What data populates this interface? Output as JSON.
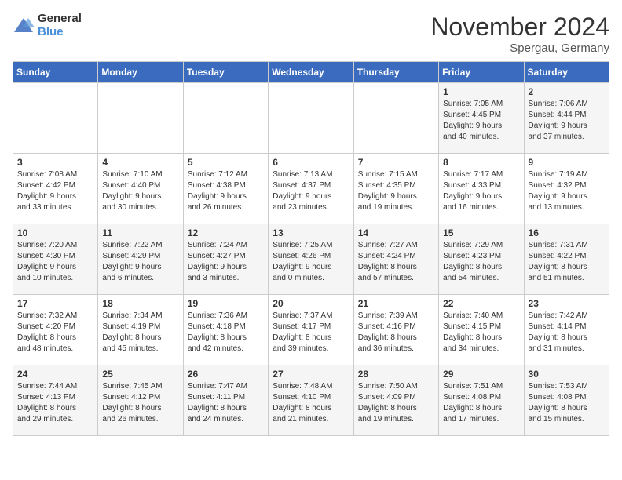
{
  "logo": {
    "general": "General",
    "blue": "Blue"
  },
  "title": "November 2024",
  "subtitle": "Spergau, Germany",
  "headers": [
    "Sunday",
    "Monday",
    "Tuesday",
    "Wednesday",
    "Thursday",
    "Friday",
    "Saturday"
  ],
  "weeks": [
    [
      {
        "day": "",
        "info": ""
      },
      {
        "day": "",
        "info": ""
      },
      {
        "day": "",
        "info": ""
      },
      {
        "day": "",
        "info": ""
      },
      {
        "day": "",
        "info": ""
      },
      {
        "day": "1",
        "info": "Sunrise: 7:05 AM\nSunset: 4:45 PM\nDaylight: 9 hours\nand 40 minutes."
      },
      {
        "day": "2",
        "info": "Sunrise: 7:06 AM\nSunset: 4:44 PM\nDaylight: 9 hours\nand 37 minutes."
      }
    ],
    [
      {
        "day": "3",
        "info": "Sunrise: 7:08 AM\nSunset: 4:42 PM\nDaylight: 9 hours\nand 33 minutes."
      },
      {
        "day": "4",
        "info": "Sunrise: 7:10 AM\nSunset: 4:40 PM\nDaylight: 9 hours\nand 30 minutes."
      },
      {
        "day": "5",
        "info": "Sunrise: 7:12 AM\nSunset: 4:38 PM\nDaylight: 9 hours\nand 26 minutes."
      },
      {
        "day": "6",
        "info": "Sunrise: 7:13 AM\nSunset: 4:37 PM\nDaylight: 9 hours\nand 23 minutes."
      },
      {
        "day": "7",
        "info": "Sunrise: 7:15 AM\nSunset: 4:35 PM\nDaylight: 9 hours\nand 19 minutes."
      },
      {
        "day": "8",
        "info": "Sunrise: 7:17 AM\nSunset: 4:33 PM\nDaylight: 9 hours\nand 16 minutes."
      },
      {
        "day": "9",
        "info": "Sunrise: 7:19 AM\nSunset: 4:32 PM\nDaylight: 9 hours\nand 13 minutes."
      }
    ],
    [
      {
        "day": "10",
        "info": "Sunrise: 7:20 AM\nSunset: 4:30 PM\nDaylight: 9 hours\nand 10 minutes."
      },
      {
        "day": "11",
        "info": "Sunrise: 7:22 AM\nSunset: 4:29 PM\nDaylight: 9 hours\nand 6 minutes."
      },
      {
        "day": "12",
        "info": "Sunrise: 7:24 AM\nSunset: 4:27 PM\nDaylight: 9 hours\nand 3 minutes."
      },
      {
        "day": "13",
        "info": "Sunrise: 7:25 AM\nSunset: 4:26 PM\nDaylight: 9 hours\nand 0 minutes."
      },
      {
        "day": "14",
        "info": "Sunrise: 7:27 AM\nSunset: 4:24 PM\nDaylight: 8 hours\nand 57 minutes."
      },
      {
        "day": "15",
        "info": "Sunrise: 7:29 AM\nSunset: 4:23 PM\nDaylight: 8 hours\nand 54 minutes."
      },
      {
        "day": "16",
        "info": "Sunrise: 7:31 AM\nSunset: 4:22 PM\nDaylight: 8 hours\nand 51 minutes."
      }
    ],
    [
      {
        "day": "17",
        "info": "Sunrise: 7:32 AM\nSunset: 4:20 PM\nDaylight: 8 hours\nand 48 minutes."
      },
      {
        "day": "18",
        "info": "Sunrise: 7:34 AM\nSunset: 4:19 PM\nDaylight: 8 hours\nand 45 minutes."
      },
      {
        "day": "19",
        "info": "Sunrise: 7:36 AM\nSunset: 4:18 PM\nDaylight: 8 hours\nand 42 minutes."
      },
      {
        "day": "20",
        "info": "Sunrise: 7:37 AM\nSunset: 4:17 PM\nDaylight: 8 hours\nand 39 minutes."
      },
      {
        "day": "21",
        "info": "Sunrise: 7:39 AM\nSunset: 4:16 PM\nDaylight: 8 hours\nand 36 minutes."
      },
      {
        "day": "22",
        "info": "Sunrise: 7:40 AM\nSunset: 4:15 PM\nDaylight: 8 hours\nand 34 minutes."
      },
      {
        "day": "23",
        "info": "Sunrise: 7:42 AM\nSunset: 4:14 PM\nDaylight: 8 hours\nand 31 minutes."
      }
    ],
    [
      {
        "day": "24",
        "info": "Sunrise: 7:44 AM\nSunset: 4:13 PM\nDaylight: 8 hours\nand 29 minutes."
      },
      {
        "day": "25",
        "info": "Sunrise: 7:45 AM\nSunset: 4:12 PM\nDaylight: 8 hours\nand 26 minutes."
      },
      {
        "day": "26",
        "info": "Sunrise: 7:47 AM\nSunset: 4:11 PM\nDaylight: 8 hours\nand 24 minutes."
      },
      {
        "day": "27",
        "info": "Sunrise: 7:48 AM\nSunset: 4:10 PM\nDaylight: 8 hours\nand 21 minutes."
      },
      {
        "day": "28",
        "info": "Sunrise: 7:50 AM\nSunset: 4:09 PM\nDaylight: 8 hours\nand 19 minutes."
      },
      {
        "day": "29",
        "info": "Sunrise: 7:51 AM\nSunset: 4:08 PM\nDaylight: 8 hours\nand 17 minutes."
      },
      {
        "day": "30",
        "info": "Sunrise: 7:53 AM\nSunset: 4:08 PM\nDaylight: 8 hours\nand 15 minutes."
      }
    ]
  ]
}
